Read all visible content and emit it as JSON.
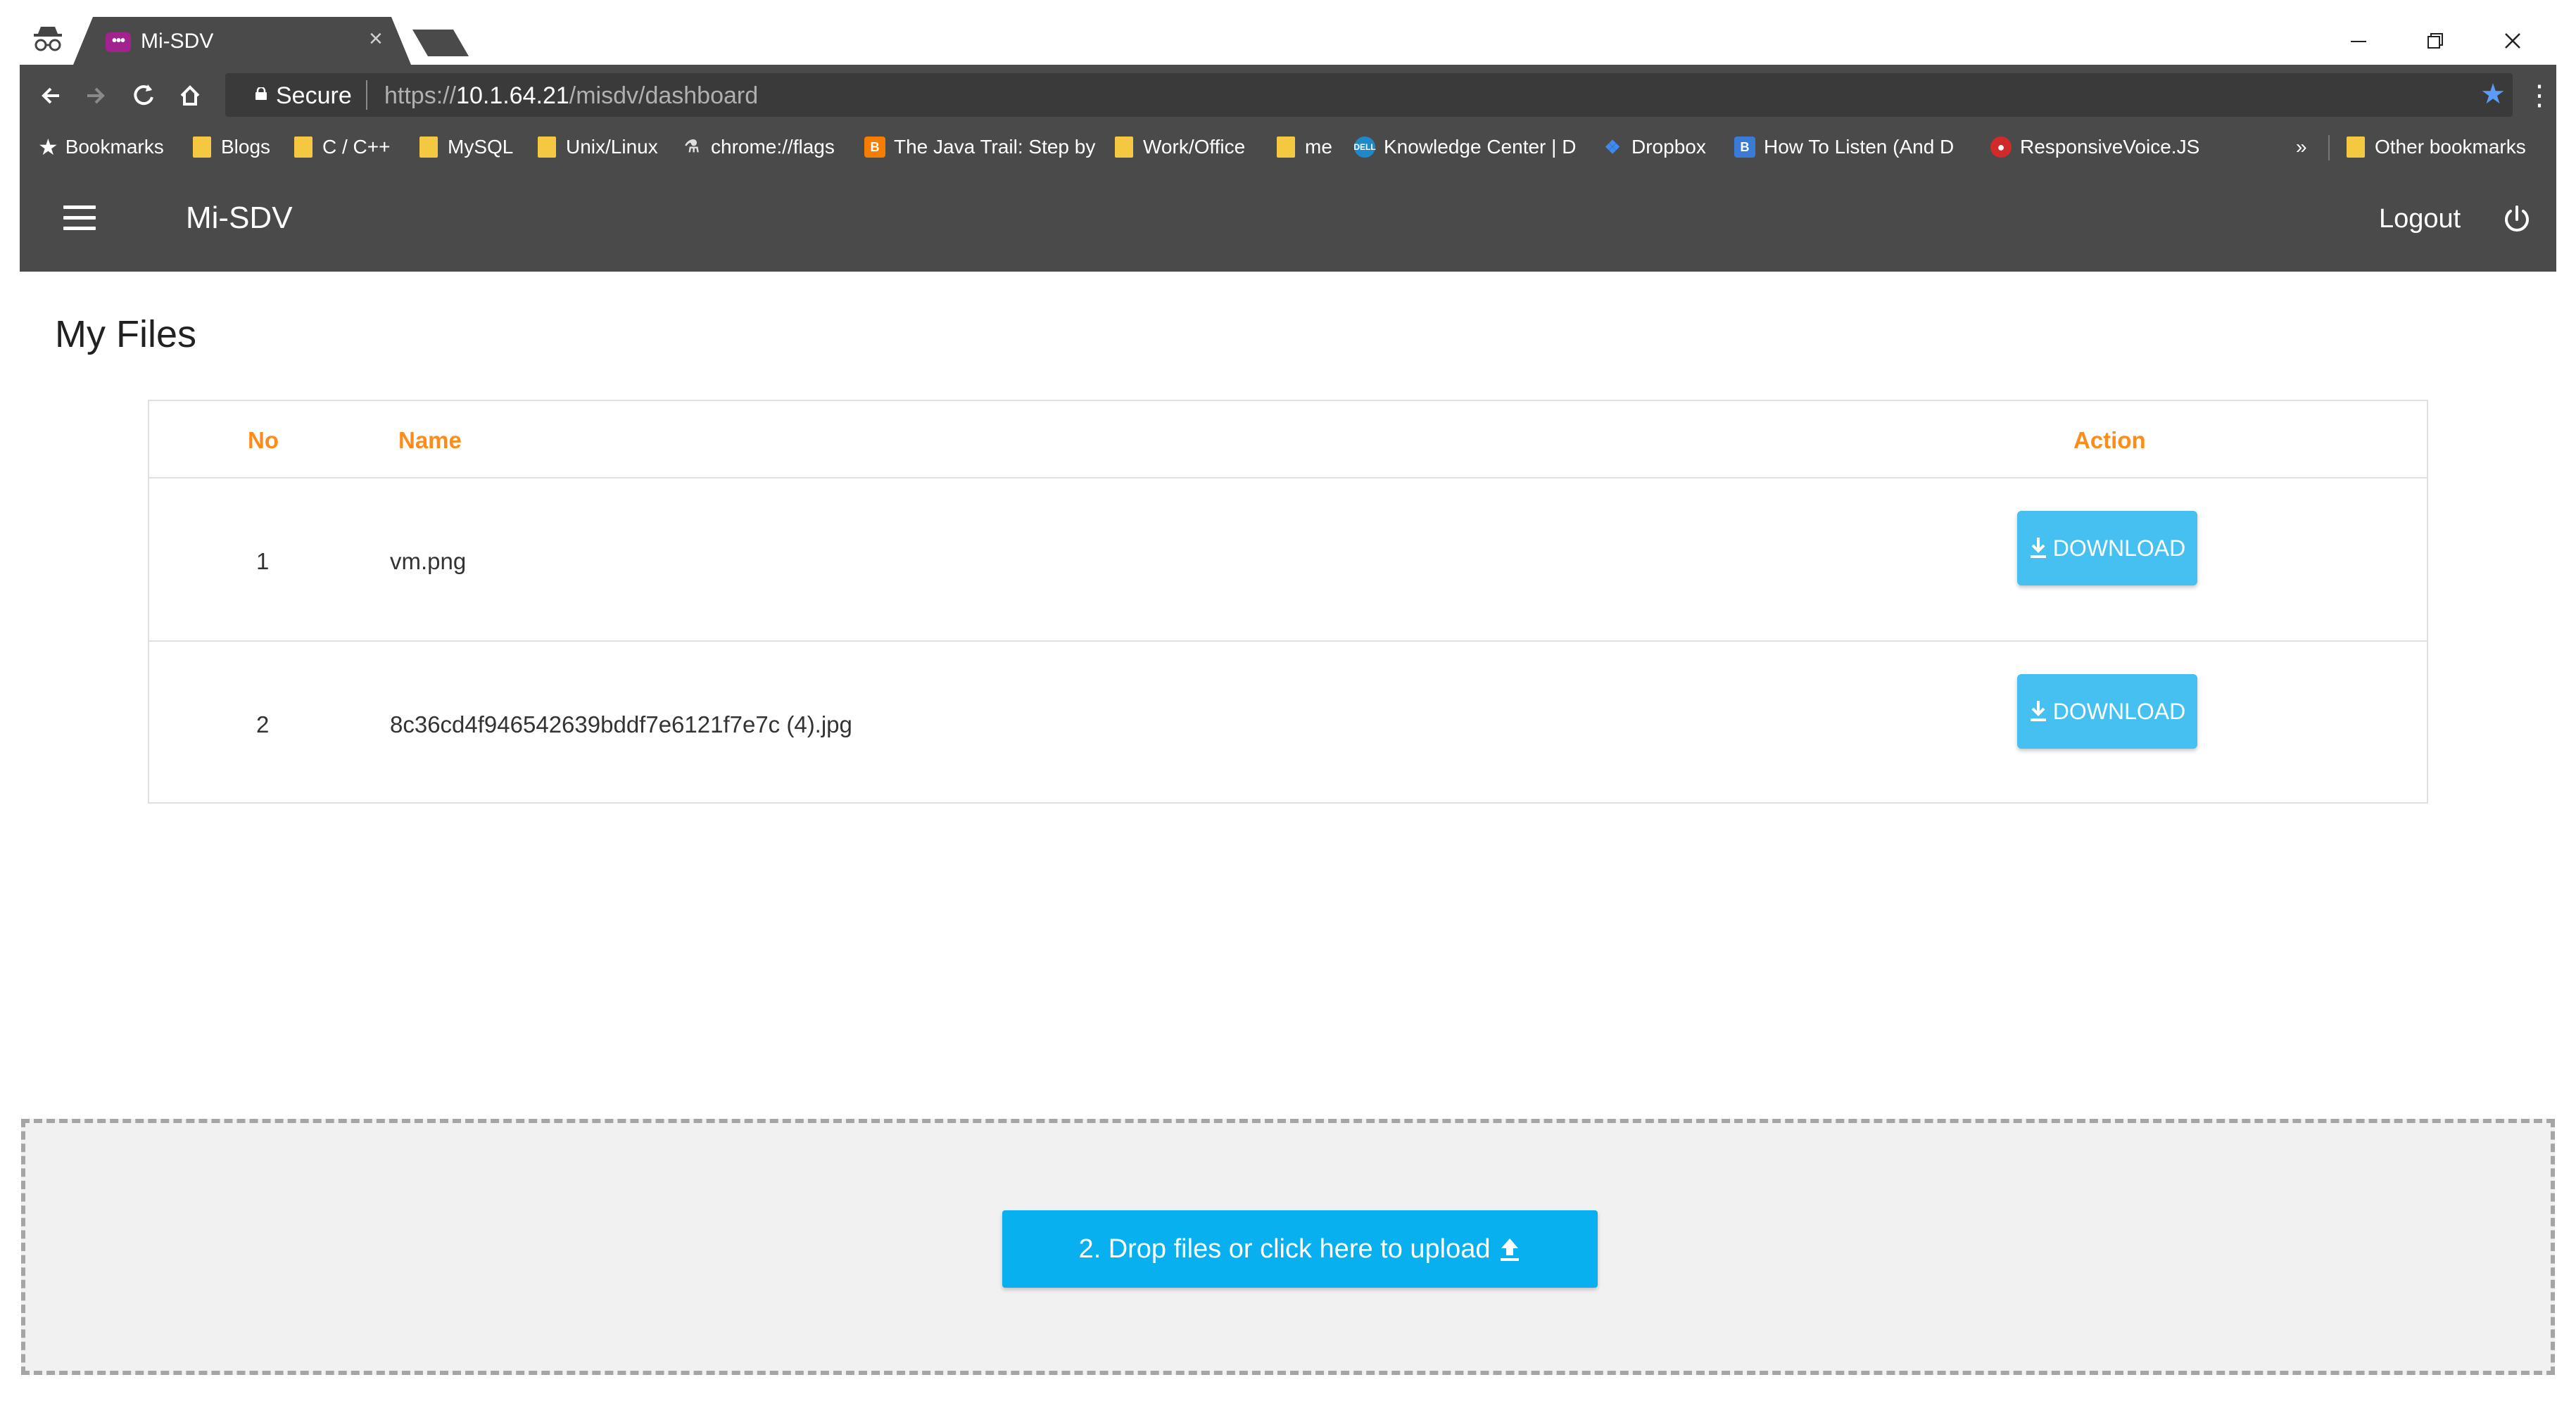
{
  "browser": {
    "tab_title": "Mi-SDV",
    "tab_favicon_text": "•••",
    "tab_close": "×",
    "secure_label": "Secure",
    "url_scheme": "https://",
    "url_host": "10.1.64.21",
    "url_path": "/misdv/dashboard",
    "bookmarks": [
      {
        "label": "Bookmarks",
        "icon": "star-icon"
      },
      {
        "label": "Blogs",
        "icon": "folder-icon"
      },
      {
        "label": "C / C++",
        "icon": "folder-icon"
      },
      {
        "label": "MySQL",
        "icon": "folder-icon"
      },
      {
        "label": "Unix/Linux",
        "icon": "folder-icon"
      },
      {
        "label": "chrome://flags",
        "icon": "flags-icon"
      },
      {
        "label": "The Java Trail: Step by",
        "icon": "blogger-icon"
      },
      {
        "label": "Work/Office",
        "icon": "folder-icon"
      },
      {
        "label": "me",
        "icon": "folder-icon"
      },
      {
        "label": "Knowledge Center | D",
        "icon": "dell-icon"
      },
      {
        "label": "Dropbox",
        "icon": "dropbox-icon"
      },
      {
        "label": "How To Listen (And D",
        "icon": "b-icon"
      },
      {
        "label": "ResponsiveVoice.JS",
        "icon": "responsivevoice-icon"
      }
    ],
    "overflow": "»",
    "other_bookmarks": "Other bookmarks"
  },
  "app": {
    "title": "Mi-SDV",
    "logout_label": "Logout"
  },
  "page": {
    "title": "My Files",
    "table": {
      "headers": {
        "no": "No",
        "name": "Name",
        "action": "Action"
      },
      "rows": [
        {
          "no": "1",
          "name": "vm.png",
          "action": "DOWNLOAD"
        },
        {
          "no": "2",
          "name": "8c36cd4f946542639bddf7e6121f7e7c (4).jpg",
          "action": "DOWNLOAD"
        }
      ]
    }
  },
  "upload": {
    "label": "2. Drop files or click here to upload"
  },
  "colors": {
    "header_bg": "#4a4a4a",
    "accent_orange": "#ff8c1a",
    "download_button": "#45c0f0",
    "upload_button": "#09b0f0",
    "bookmark_star": "#5b9cf5"
  }
}
